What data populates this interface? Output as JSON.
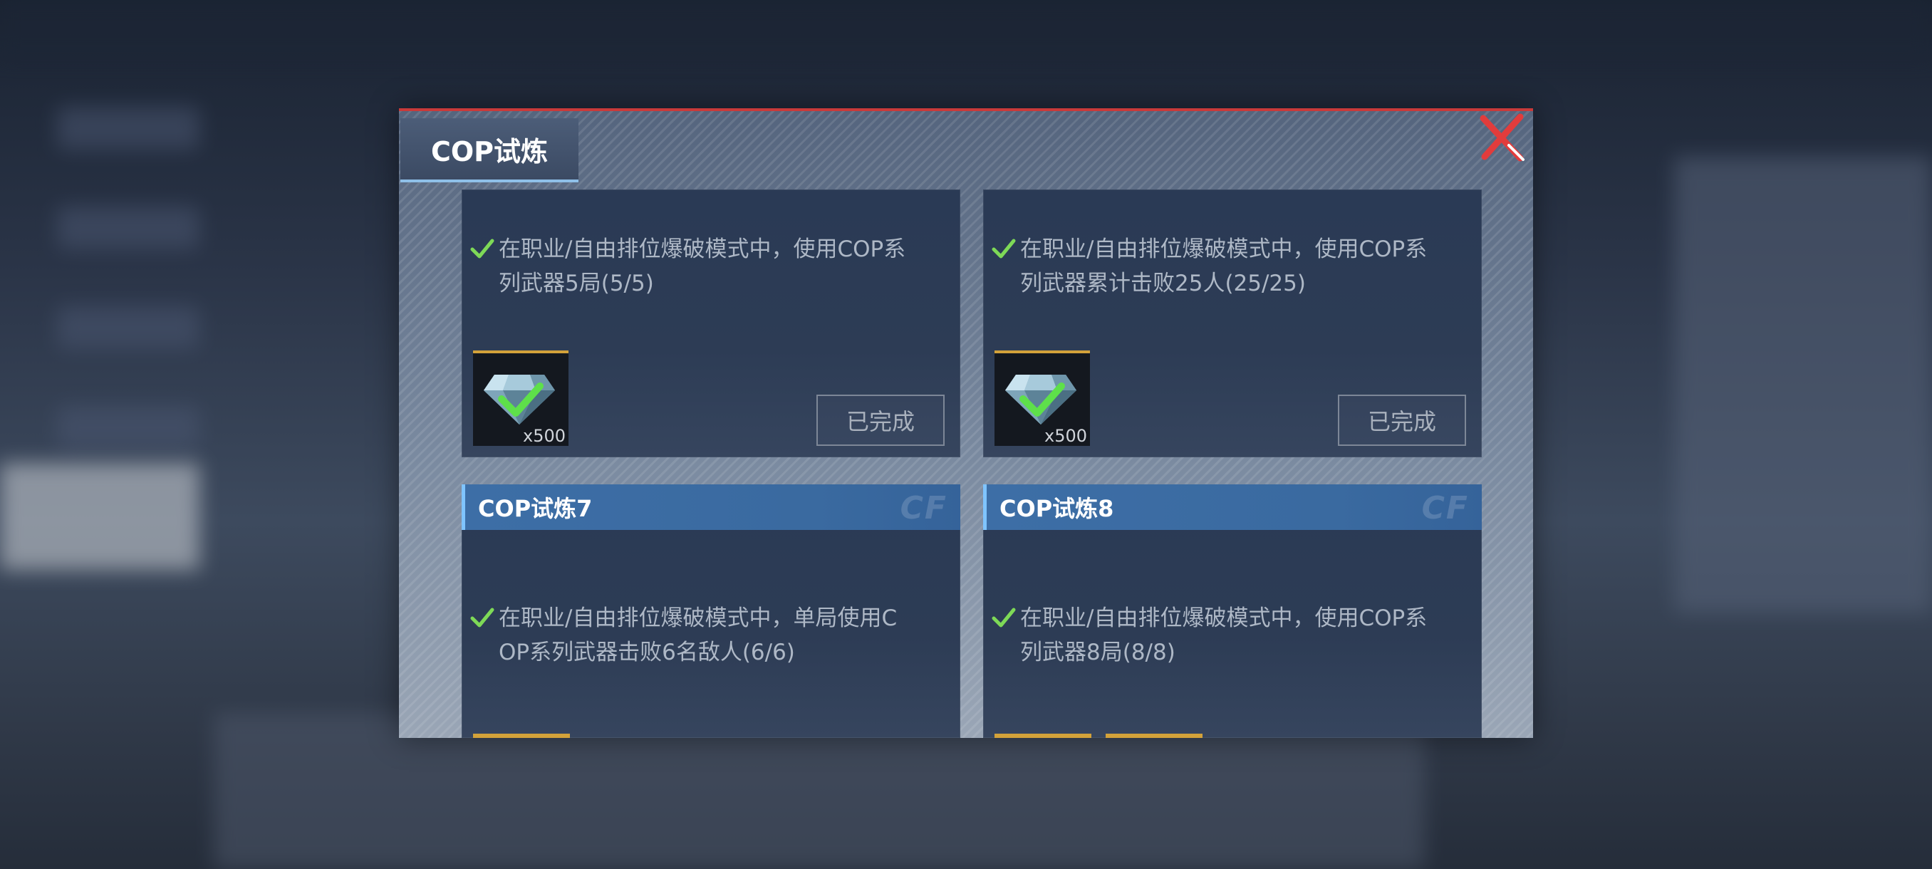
{
  "dialog": {
    "tab_title": "COP试炼",
    "close_icon": "close-x-icon"
  },
  "cards": [
    {
      "header": "",
      "task": "在职业/自由排位爆破模式中，使用COP系列武器5局(5/5)",
      "task_lines": [
        "在职业/自由排位爆破模式中，使用COP系",
        "列武器5局(5/5)"
      ],
      "reward_qty": "x500",
      "status": "已完成"
    },
    {
      "header": "",
      "task": "在职业/自由排位爆破模式中，使用COP系列武器累计击败25人(25/25)",
      "task_lines": [
        "在职业/自由排位爆破模式中，使用COP系",
        "列武器累计击败25人(25/25)"
      ],
      "reward_qty": "x500",
      "status": "已完成"
    },
    {
      "header": "COP试炼7",
      "task": "在职业/自由排位爆破模式中，单局使用COP系列武器击败6名敌人(6/6)",
      "task_lines": [
        "在职业/自由排位爆破模式中，单局使用C",
        "OP系列武器击败6名敌人(6/6)"
      ]
    },
    {
      "header": "COP试炼8",
      "task": "在职业/自由排位爆破模式中，使用COP系列武器8局(8/8)",
      "task_lines": [
        "在职业/自由排位爆破模式中，使用COP系",
        "列武器8局(8/8)"
      ]
    }
  ],
  "colors": {
    "accent_red": "#c93a3a",
    "header_blue": "#3d6ea6",
    "check_green": "#7ed957",
    "gold": "#d3a23a"
  }
}
